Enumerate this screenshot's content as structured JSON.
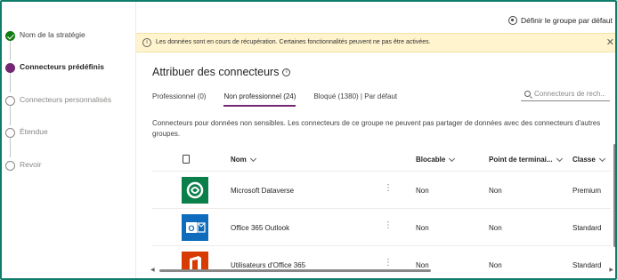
{
  "stepper": {
    "steps": [
      {
        "label": "Nom de la stratégie",
        "state": "done"
      },
      {
        "label": "Connecteurs prédéfinis",
        "state": "current"
      },
      {
        "label": "Connecteurs personnalisés",
        "state": "pending"
      },
      {
        "label": "Étendue",
        "state": "pending"
      },
      {
        "label": "Revoir",
        "state": "pending"
      }
    ]
  },
  "header": {
    "default_group_label": "Définir le groupe par défaut",
    "icon": "gear-icon"
  },
  "banner": {
    "message": "Les données sont en cours de récupération. Certaines fonctionnalités peuvent ne pas être activées.",
    "close": "✕"
  },
  "page": {
    "title": "Attribuer des connecteurs",
    "description": "Connecteurs pour données non sensibles. Les connecteurs de ce groupe ne peuvent pas partager de données avec des connecteurs d'autres groupes."
  },
  "tabs": [
    {
      "label": "Professionnel (0)",
      "active": false
    },
    {
      "label": "Non professionnel (24)",
      "active": true
    },
    {
      "label": "Bloqué (1380) | Par défaut",
      "active": false
    }
  ],
  "search": {
    "placeholder": "Connecteurs de rech..."
  },
  "table": {
    "columns": [
      "Nom",
      "Blocable",
      "Point de terminai...",
      "Classe"
    ],
    "rows": [
      {
        "name": "Microsoft Dataverse",
        "blockable": "Non",
        "endpoint": "Non",
        "class": "Premium",
        "logo": "dataverse-logo"
      },
      {
        "name": "Office 365 Outlook",
        "blockable": "Non",
        "endpoint": "Non",
        "class": "Standard",
        "logo": "outlook-logo"
      },
      {
        "name": "Utilisateurs d'Office 365",
        "blockable": "Non",
        "endpoint": "Non",
        "class": "Standard",
        "logo": "office365-logo"
      }
    ]
  },
  "colors": {
    "accent": "#742774",
    "done": "#107c10",
    "banner_bg": "#fff4ce",
    "frame": "#0f7d6b",
    "dataverse": "#0b7f4a",
    "outlook": "#0f6cbd",
    "office": "#d83b01"
  }
}
